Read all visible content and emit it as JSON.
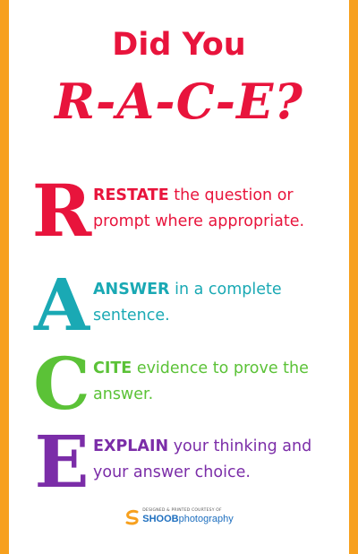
{
  "title": {
    "line1": "Did You",
    "line2": "R-A-C-E?"
  },
  "colors": {
    "title": "#e8143c",
    "border": "#f7a01e",
    "r": "#e8143c",
    "a": "#1aa9b4",
    "c": "#5bc237",
    "e": "#7b2da8",
    "brand": "#1e6fbf"
  },
  "steps": [
    {
      "letter": "R",
      "keyword": "RESTATE",
      "rest": " the question or prompt where appropriate."
    },
    {
      "letter": "A",
      "keyword": "ANSWER",
      "rest": " in a complete sentence."
    },
    {
      "letter": "C",
      "keyword": "CITE",
      "rest": " evidence to prove the answer."
    },
    {
      "letter": "E",
      "keyword": "EXPLAIN",
      "rest": " your thinking and your answer choice."
    }
  ],
  "credit": {
    "small": "DESIGNED & PRINTED COURTESY OF",
    "brand_bold": "SHOOB",
    "brand_rest": "photography",
    "logo_icon": "swirl-logo-icon"
  }
}
